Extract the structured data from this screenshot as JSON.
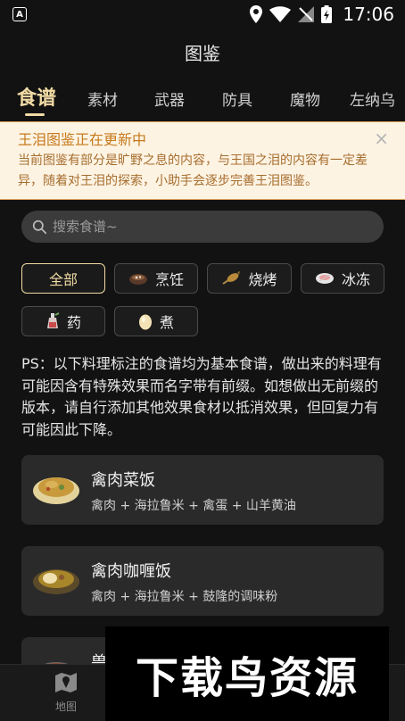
{
  "status_bar": {
    "time": "17:06",
    "app_badge": "A"
  },
  "header": {
    "title": "图鉴"
  },
  "tabs": [
    {
      "label": "食谱",
      "active": true
    },
    {
      "label": "素材"
    },
    {
      "label": "武器"
    },
    {
      "label": "防具"
    },
    {
      "label": "魔物"
    },
    {
      "label": "左纳乌"
    }
  ],
  "notice": {
    "title": "王泪图鉴正在更新中",
    "body": "当前图鉴有部分是旷野之息的内容，与王国之泪的内容有一定差异，随着对王泪的探索，小助手会逐步完善王泪图鉴。",
    "close_icon": "×"
  },
  "search": {
    "placeholder": "搜索食谱~"
  },
  "filters": [
    {
      "label": "全部",
      "active": true
    },
    {
      "label": "烹饪",
      "icon": "cooking-pot-icon"
    },
    {
      "label": "烧烤",
      "icon": "roast-fish-icon"
    },
    {
      "label": "冰冻",
      "icon": "frozen-icon"
    },
    {
      "label": "药",
      "icon": "potion-icon"
    },
    {
      "label": "煮",
      "icon": "boiled-egg-icon"
    }
  ],
  "ps_note": "PS：以下料理标注的食谱均为基本食谱，做出来的料理有可能因含有特殊效果而名字带有前缀。如想做出无前缀的版本，请自行添加其他效果食材以抵消效果，但回复力有可能因此下降。",
  "recipes": [
    {
      "name": "禽肉菜饭",
      "ingredients": "禽肉 + 海拉鲁米 + 禽蛋 + 山羊黄油"
    },
    {
      "name": "禽肉咖喱饭",
      "ingredients": "禽肉 + 海拉鲁米 + 鼓隆的调味粉"
    },
    {
      "name": "兽"
    }
  ],
  "bottom_nav": [
    {
      "label": "地图",
      "icon": "map-icon"
    }
  ],
  "watermark": "下载鸟资源",
  "colors": {
    "accent": "#f1dba5",
    "notice_bg": "#fdf3e3",
    "notice_title": "#c67a1c"
  }
}
